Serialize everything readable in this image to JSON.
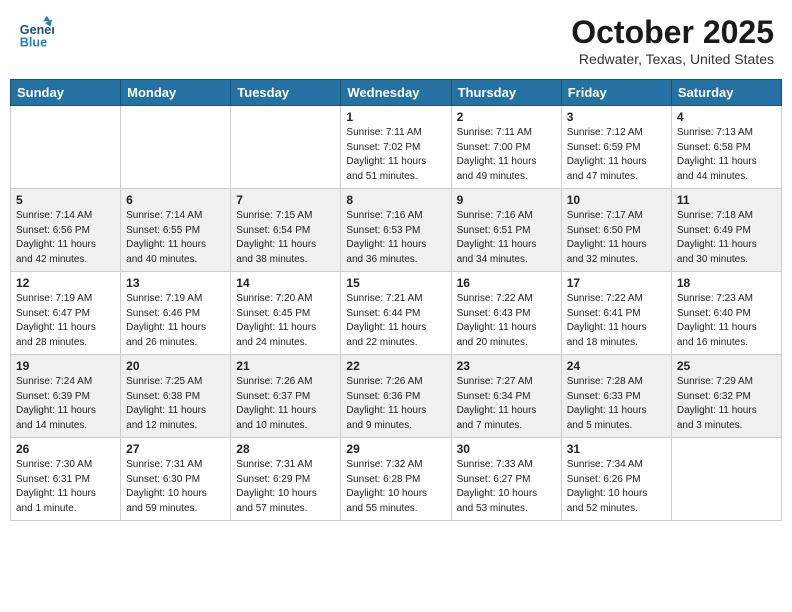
{
  "header": {
    "logo_general": "General",
    "logo_blue": "Blue",
    "month": "October 2025",
    "location": "Redwater, Texas, United States"
  },
  "days_of_week": [
    "Sunday",
    "Monday",
    "Tuesday",
    "Wednesday",
    "Thursday",
    "Friday",
    "Saturday"
  ],
  "weeks": [
    [
      {
        "day": "",
        "sunrise": "",
        "sunset": "",
        "daylight": ""
      },
      {
        "day": "",
        "sunrise": "",
        "sunset": "",
        "daylight": ""
      },
      {
        "day": "",
        "sunrise": "",
        "sunset": "",
        "daylight": ""
      },
      {
        "day": "1",
        "sunrise": "Sunrise: 7:11 AM",
        "sunset": "Sunset: 7:02 PM",
        "daylight": "Daylight: 11 hours and 51 minutes."
      },
      {
        "day": "2",
        "sunrise": "Sunrise: 7:11 AM",
        "sunset": "Sunset: 7:00 PM",
        "daylight": "Daylight: 11 hours and 49 minutes."
      },
      {
        "day": "3",
        "sunrise": "Sunrise: 7:12 AM",
        "sunset": "Sunset: 6:59 PM",
        "daylight": "Daylight: 11 hours and 47 minutes."
      },
      {
        "day": "4",
        "sunrise": "Sunrise: 7:13 AM",
        "sunset": "Sunset: 6:58 PM",
        "daylight": "Daylight: 11 hours and 44 minutes."
      }
    ],
    [
      {
        "day": "5",
        "sunrise": "Sunrise: 7:14 AM",
        "sunset": "Sunset: 6:56 PM",
        "daylight": "Daylight: 11 hours and 42 minutes."
      },
      {
        "day": "6",
        "sunrise": "Sunrise: 7:14 AM",
        "sunset": "Sunset: 6:55 PM",
        "daylight": "Daylight: 11 hours and 40 minutes."
      },
      {
        "day": "7",
        "sunrise": "Sunrise: 7:15 AM",
        "sunset": "Sunset: 6:54 PM",
        "daylight": "Daylight: 11 hours and 38 minutes."
      },
      {
        "day": "8",
        "sunrise": "Sunrise: 7:16 AM",
        "sunset": "Sunset: 6:53 PM",
        "daylight": "Daylight: 11 hours and 36 minutes."
      },
      {
        "day": "9",
        "sunrise": "Sunrise: 7:16 AM",
        "sunset": "Sunset: 6:51 PM",
        "daylight": "Daylight: 11 hours and 34 minutes."
      },
      {
        "day": "10",
        "sunrise": "Sunrise: 7:17 AM",
        "sunset": "Sunset: 6:50 PM",
        "daylight": "Daylight: 11 hours and 32 minutes."
      },
      {
        "day": "11",
        "sunrise": "Sunrise: 7:18 AM",
        "sunset": "Sunset: 6:49 PM",
        "daylight": "Daylight: 11 hours and 30 minutes."
      }
    ],
    [
      {
        "day": "12",
        "sunrise": "Sunrise: 7:19 AM",
        "sunset": "Sunset: 6:47 PM",
        "daylight": "Daylight: 11 hours and 28 minutes."
      },
      {
        "day": "13",
        "sunrise": "Sunrise: 7:19 AM",
        "sunset": "Sunset: 6:46 PM",
        "daylight": "Daylight: 11 hours and 26 minutes."
      },
      {
        "day": "14",
        "sunrise": "Sunrise: 7:20 AM",
        "sunset": "Sunset: 6:45 PM",
        "daylight": "Daylight: 11 hours and 24 minutes."
      },
      {
        "day": "15",
        "sunrise": "Sunrise: 7:21 AM",
        "sunset": "Sunset: 6:44 PM",
        "daylight": "Daylight: 11 hours and 22 minutes."
      },
      {
        "day": "16",
        "sunrise": "Sunrise: 7:22 AM",
        "sunset": "Sunset: 6:43 PM",
        "daylight": "Daylight: 11 hours and 20 minutes."
      },
      {
        "day": "17",
        "sunrise": "Sunrise: 7:22 AM",
        "sunset": "Sunset: 6:41 PM",
        "daylight": "Daylight: 11 hours and 18 minutes."
      },
      {
        "day": "18",
        "sunrise": "Sunrise: 7:23 AM",
        "sunset": "Sunset: 6:40 PM",
        "daylight": "Daylight: 11 hours and 16 minutes."
      }
    ],
    [
      {
        "day": "19",
        "sunrise": "Sunrise: 7:24 AM",
        "sunset": "Sunset: 6:39 PM",
        "daylight": "Daylight: 11 hours and 14 minutes."
      },
      {
        "day": "20",
        "sunrise": "Sunrise: 7:25 AM",
        "sunset": "Sunset: 6:38 PM",
        "daylight": "Daylight: 11 hours and 12 minutes."
      },
      {
        "day": "21",
        "sunrise": "Sunrise: 7:26 AM",
        "sunset": "Sunset: 6:37 PM",
        "daylight": "Daylight: 11 hours and 10 minutes."
      },
      {
        "day": "22",
        "sunrise": "Sunrise: 7:26 AM",
        "sunset": "Sunset: 6:36 PM",
        "daylight": "Daylight: 11 hours and 9 minutes."
      },
      {
        "day": "23",
        "sunrise": "Sunrise: 7:27 AM",
        "sunset": "Sunset: 6:34 PM",
        "daylight": "Daylight: 11 hours and 7 minutes."
      },
      {
        "day": "24",
        "sunrise": "Sunrise: 7:28 AM",
        "sunset": "Sunset: 6:33 PM",
        "daylight": "Daylight: 11 hours and 5 minutes."
      },
      {
        "day": "25",
        "sunrise": "Sunrise: 7:29 AM",
        "sunset": "Sunset: 6:32 PM",
        "daylight": "Daylight: 11 hours and 3 minutes."
      }
    ],
    [
      {
        "day": "26",
        "sunrise": "Sunrise: 7:30 AM",
        "sunset": "Sunset: 6:31 PM",
        "daylight": "Daylight: 11 hours and 1 minute."
      },
      {
        "day": "27",
        "sunrise": "Sunrise: 7:31 AM",
        "sunset": "Sunset: 6:30 PM",
        "daylight": "Daylight: 10 hours and 59 minutes."
      },
      {
        "day": "28",
        "sunrise": "Sunrise: 7:31 AM",
        "sunset": "Sunset: 6:29 PM",
        "daylight": "Daylight: 10 hours and 57 minutes."
      },
      {
        "day": "29",
        "sunrise": "Sunrise: 7:32 AM",
        "sunset": "Sunset: 6:28 PM",
        "daylight": "Daylight: 10 hours and 55 minutes."
      },
      {
        "day": "30",
        "sunrise": "Sunrise: 7:33 AM",
        "sunset": "Sunset: 6:27 PM",
        "daylight": "Daylight: 10 hours and 53 minutes."
      },
      {
        "day": "31",
        "sunrise": "Sunrise: 7:34 AM",
        "sunset": "Sunset: 6:26 PM",
        "daylight": "Daylight: 10 hours and 52 minutes."
      },
      {
        "day": "",
        "sunrise": "",
        "sunset": "",
        "daylight": ""
      }
    ]
  ]
}
